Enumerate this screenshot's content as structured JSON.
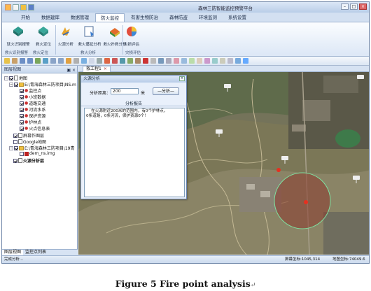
{
  "window": {
    "title": "森林三防智能监控预警平台",
    "controls": [
      "–",
      "□",
      "×"
    ]
  },
  "menu": {
    "tabs": [
      "开始",
      "数据建库",
      "数据管理",
      "防火监控",
      "有害生物防治",
      "森林防盗",
      "环境监测",
      "系统设置"
    ],
    "active_index": 3
  },
  "ribbon": {
    "buttons": [
      "就火识别报警",
      "救火定位",
      "火源分析",
      "救火蔓延分析",
      "救火扑救分析",
      "灾损评估"
    ],
    "groups": [
      "救火识别报警",
      "救火定位",
      "救火分析",
      "灾损评估"
    ]
  },
  "left_panel": {
    "title": "图层视图",
    "pin_buttons": "▣ ×",
    "tree": [
      {
        "label": "地图",
        "level": 0
      },
      {
        "label": "E:\\青海森林三防项目\\NS.m",
        "level": 1
      },
      {
        "label": "监控点",
        "level": 2
      },
      {
        "label": "小班数据",
        "level": 2
      },
      {
        "label": "道路交通",
        "level": 2
      },
      {
        "label": "河流水系",
        "level": 2
      },
      {
        "label": "保护资源",
        "level": 2
      },
      {
        "label": "护林点",
        "level": 2
      },
      {
        "label": "火点信息表",
        "level": 2
      },
      {
        "label": "屏幕作图层",
        "level": 1
      },
      {
        "label": "Google地图",
        "level": 1
      },
      {
        "label": "E:\\青海森林三防项目\\19青",
        "level": 1
      },
      {
        "label": "dem_ns.img",
        "level": 2
      },
      {
        "label": "火源分析层",
        "level": 1
      }
    ],
    "bottom_tabs": [
      "图层视图",
      "监控点列表"
    ]
  },
  "map_tab": {
    "label": "救工程1",
    "close": "×"
  },
  "dialog": {
    "title": "火源分析",
    "close": "×",
    "distance_label": "分析距离：",
    "distance_value": "200",
    "unit": "米",
    "button_label": "分析",
    "report_header": "分析报告",
    "report_lines": [
      "    在火源附近200米的范围内，有0个护林点，",
      "0条道路，0条河流，保护资源0个！"
    ]
  },
  "statusbar": {
    "left": "完成分析...",
    "screen_coord": "屏幕坐标:1045,314",
    "map_coord": "地图坐标:74049.6"
  },
  "caption": "Figure 5 Fire point analysis",
  "caption_mark": "↵"
}
